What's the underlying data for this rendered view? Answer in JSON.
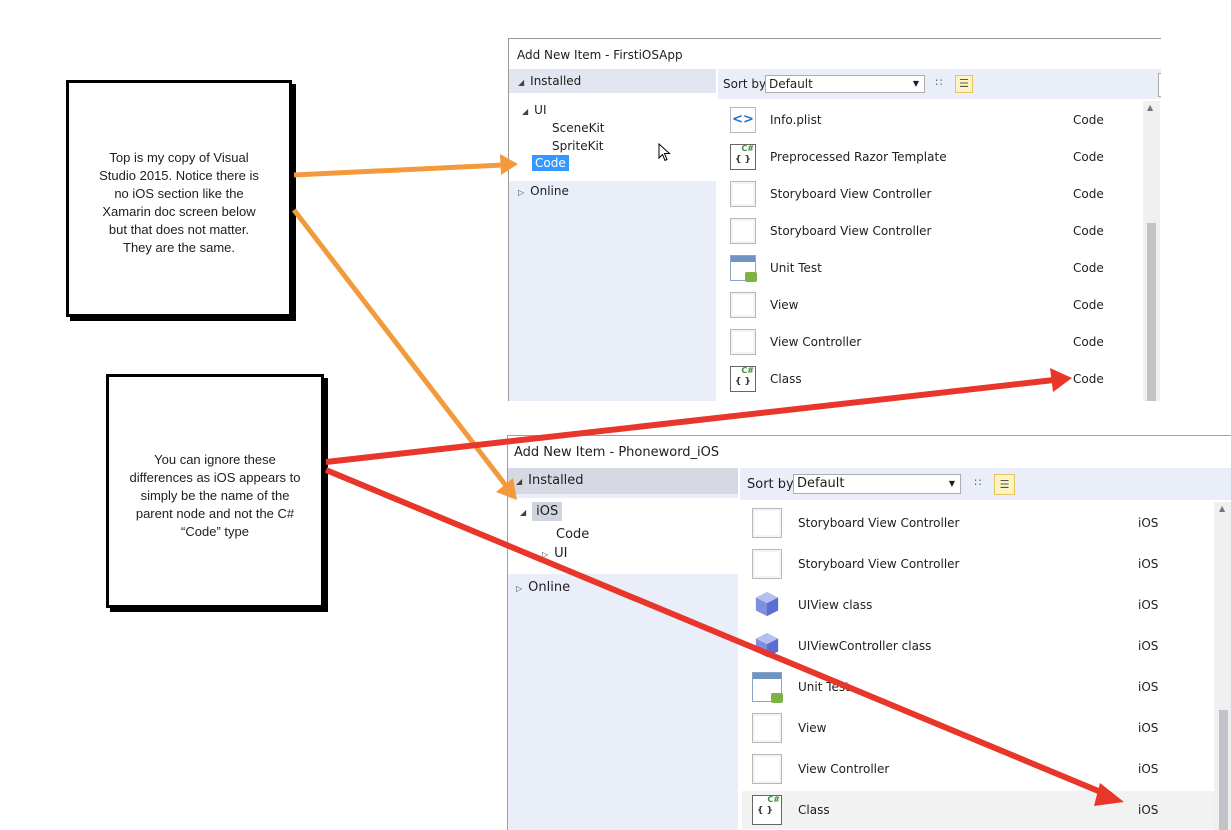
{
  "note_top": {
    "text": "Top is my copy of Visual Studio 2015. Notice there is no iOS section like the Xamarin doc screen below but that does not matter. They are the same."
  },
  "note_bottom": {
    "text": "You can ignore these differences as iOS appears to simply be the name of the parent node and not the C# “Code” type"
  },
  "dialog_top": {
    "title": "Add New Item - FirstiOSApp",
    "installed": "Installed",
    "tree": [
      "UI",
      "SceneKit",
      "SpriteKit",
      "Code"
    ],
    "online": "Online",
    "sort_label": "Sort by:",
    "sort_value": "Default",
    "items": [
      {
        "name": "Info.plist",
        "type": "Code",
        "icon": "plist-icon"
      },
      {
        "name": "Preprocessed Razor Template",
        "type": "Code",
        "icon": "csharp-file-icon"
      },
      {
        "name": "Storyboard View Controller",
        "type": "Code",
        "icon": "blank-template-icon"
      },
      {
        "name": "Storyboard View Controller",
        "type": "Code",
        "icon": "blank-template-icon"
      },
      {
        "name": "Unit Test",
        "type": "Code",
        "icon": "unit-test-icon"
      },
      {
        "name": "View",
        "type": "Code",
        "icon": "blank-template-icon"
      },
      {
        "name": "View Controller",
        "type": "Code",
        "icon": "blank-template-icon"
      },
      {
        "name": "Class",
        "type": "Code",
        "icon": "csharp-file-icon"
      }
    ]
  },
  "dialog_bottom": {
    "title": "Add New Item - Phoneword_iOS",
    "installed": "Installed",
    "tree": [
      "iOS",
      "Code",
      "UI"
    ],
    "online": "Online",
    "sort_label": "Sort by:",
    "sort_value": "Default",
    "items": [
      {
        "name": "Storyboard View Controller",
        "type": "iOS",
        "icon": "blank-template-icon"
      },
      {
        "name": "Storyboard View Controller",
        "type": "iOS",
        "icon": "blank-template-icon"
      },
      {
        "name": "UIView class",
        "type": "iOS",
        "icon": "cube-icon"
      },
      {
        "name": "UIViewController class",
        "type": "iOS",
        "icon": "cube-icon"
      },
      {
        "name": "Unit Test",
        "type": "iOS",
        "icon": "unit-test-icon"
      },
      {
        "name": "View",
        "type": "iOS",
        "icon": "blank-template-icon"
      },
      {
        "name": "View Controller",
        "type": "iOS",
        "icon": "blank-template-icon"
      },
      {
        "name": "Class",
        "type": "iOS",
        "icon": "csharp-file-icon"
      }
    ]
  },
  "colors": {
    "arrow_orange": "#f39a3c",
    "arrow_red": "#e8362b",
    "selection_blue": "#3399ff",
    "tree_bg": "#e9eef8"
  }
}
